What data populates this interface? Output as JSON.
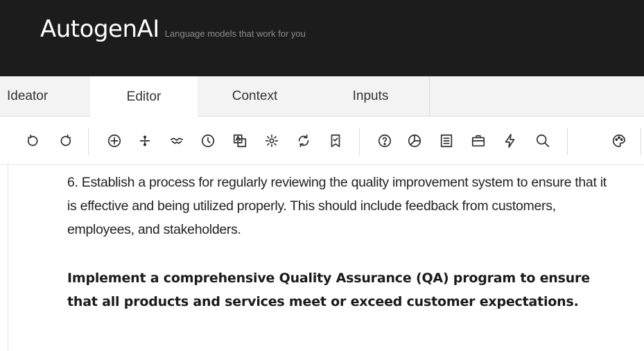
{
  "app": {
    "name": "AutogenAI",
    "tagline": "Language models that work for you"
  },
  "tabs": [
    {
      "label": "Ideator",
      "active": false
    },
    {
      "label": "Editor",
      "active": true
    },
    {
      "label": "Context",
      "active": false
    },
    {
      "label": "Inputs",
      "active": false
    }
  ],
  "toolbar": {
    "icons": [
      "undo-icon",
      "redo-icon",
      "add-circle-icon",
      "divide-icon",
      "handshake-icon",
      "clock-icon",
      "translate-icon",
      "settings-icon",
      "refresh-icon",
      "bookmark-icon",
      "help-icon",
      "chart-icon",
      "document-icon",
      "briefcase-icon",
      "lightning-icon",
      "search-icon",
      "palette-icon"
    ]
  },
  "document": {
    "paragraph": "6. Establish a process for regularly reviewing the quality improvement system to ensure that it is effective and being utilized properly. This should include feedback from customers, employees, and stakeholders.",
    "bold_paragraph": "Implement a comprehensive Quality Assurance (QA) program to ensure that all products and services meet or exceed customer expectations."
  },
  "colors": {
    "header_bg": "#1c1c1c",
    "tabbar_bg": "#f3f3f3",
    "active_tab_bg": "#ffffff"
  }
}
